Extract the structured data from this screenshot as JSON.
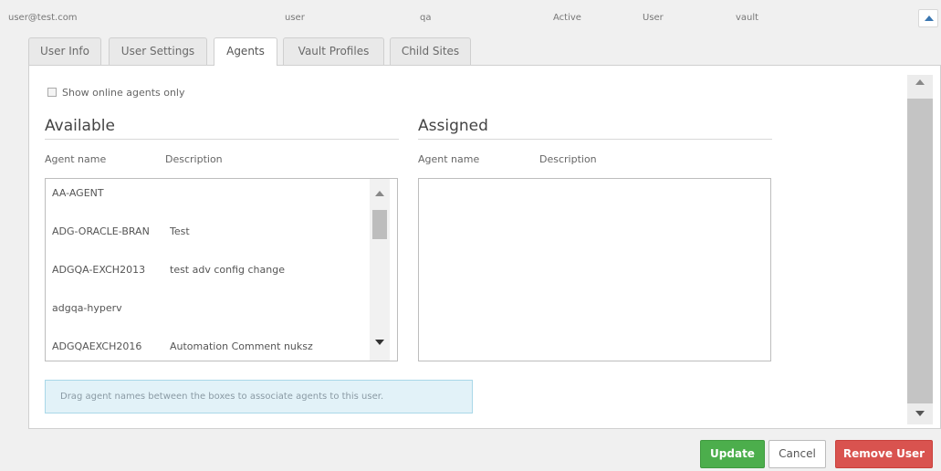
{
  "user_row": {
    "email": "user@test.com",
    "login": "user",
    "group": "qa",
    "status": "Active",
    "role": "User",
    "vault": "vault"
  },
  "tabs": [
    {
      "label": "User Info",
      "active": false
    },
    {
      "label": "User Settings",
      "active": false
    },
    {
      "label": "Agents",
      "active": true
    },
    {
      "label": "Vault Profiles",
      "active": false
    },
    {
      "label": "Child Sites",
      "active": false
    }
  ],
  "filter": {
    "online_only_label": "Show online agents only",
    "online_only_checked": false
  },
  "available": {
    "heading": "Available",
    "col_name": "Agent name",
    "col_desc": "Description",
    "agents": [
      {
        "name": "AA-AGENT",
        "description": ""
      },
      {
        "name": "ADG-ORACLE-BRAN",
        "description": "Test"
      },
      {
        "name": "ADGQA-EXCH2013",
        "description": "test adv config change"
      },
      {
        "name": "adgqa-hyperv",
        "description": ""
      },
      {
        "name": "ADGQAEXCH2016",
        "description": "Automation Comment nuksz"
      }
    ]
  },
  "assigned": {
    "heading": "Assigned",
    "col_name": "Agent name",
    "col_desc": "Description",
    "agents": []
  },
  "info_text": "Drag agent names between the boxes to associate agents to this user.",
  "buttons": {
    "update": "Update",
    "cancel": "Cancel",
    "remove": "Remove User"
  }
}
